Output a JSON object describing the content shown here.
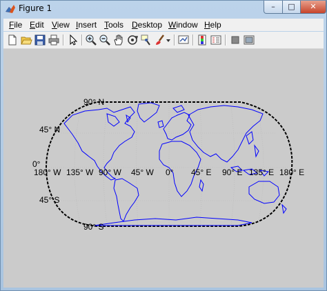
{
  "window": {
    "title": "Figure 1",
    "controls": {
      "minimize": "–",
      "maximize": "□",
      "close": "✕"
    }
  },
  "menubar": {
    "items": [
      "File",
      "Edit",
      "View",
      "Insert",
      "Tools",
      "Desktop",
      "Window",
      "Help"
    ]
  },
  "toolbar": {
    "buttons": [
      "new-figure-icon",
      "open-file-icon",
      "save-icon",
      "print-icon",
      "edit-plot-arrow-icon",
      "zoom-in-icon",
      "zoom-out-icon",
      "pan-hand-icon",
      "rotate-3d-icon",
      "data-cursor-icon",
      "brush-icon",
      "brush-dropdown-icon",
      "link-plot-icon",
      "colorbar-icon",
      "legend-icon",
      "hide-plot-tools-icon",
      "show-plot-tools-icon"
    ]
  },
  "map": {
    "lat_labels": [
      "90° N",
      "45° N",
      "0°",
      "45° S",
      "90° S"
    ],
    "lon_labels": [
      "180° W",
      "135° W",
      "90° W",
      "45° W",
      "0°",
      "45° E",
      "90° E",
      "135° E",
      "180° E"
    ],
    "colors": {
      "coast": "#0000ff",
      "frame": "#000000",
      "grid": "#b8b8b8",
      "background": "#cbcbcb"
    }
  }
}
